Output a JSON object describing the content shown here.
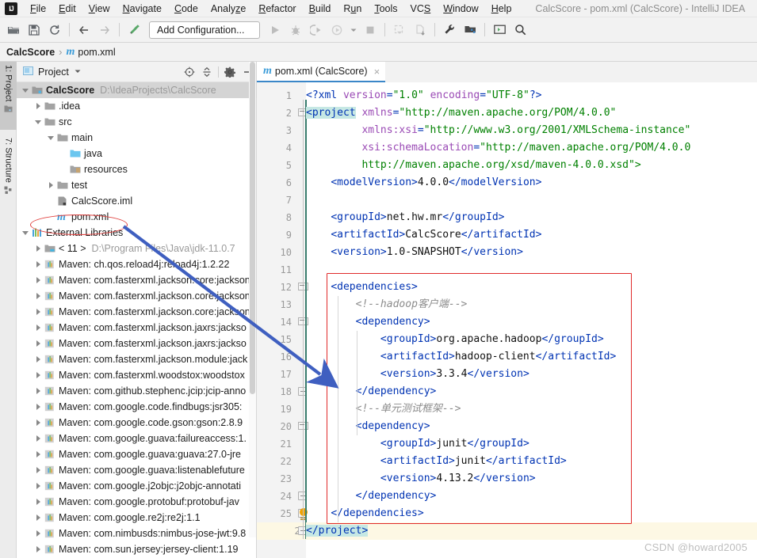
{
  "window": {
    "title": "CalcScore - pom.xml (CalcScore) - IntelliJ IDEA",
    "logo_text": "IJ"
  },
  "menubar": {
    "items": [
      {
        "label": "File",
        "mnemonic": "F"
      },
      {
        "label": "Edit",
        "mnemonic": "E"
      },
      {
        "label": "View",
        "mnemonic": "V"
      },
      {
        "label": "Navigate",
        "mnemonic": "N"
      },
      {
        "label": "Code",
        "mnemonic": "C"
      },
      {
        "label": "Analyze",
        "mnemonic": "z"
      },
      {
        "label": "Refactor",
        "mnemonic": "R"
      },
      {
        "label": "Build",
        "mnemonic": "B"
      },
      {
        "label": "Run",
        "mnemonic": "u"
      },
      {
        "label": "Tools",
        "mnemonic": "T"
      },
      {
        "label": "VCS",
        "mnemonic": "S"
      },
      {
        "label": "Window",
        "mnemonic": "W"
      },
      {
        "label": "Help",
        "mnemonic": "H"
      }
    ]
  },
  "toolbar": {
    "run_config_label": "Add Configuration...",
    "icons": [
      "open-folder-icon",
      "save-all-icon",
      "sync-refresh-icon",
      "back-arrow-icon",
      "forward-arrow-icon",
      "build-hammer-icon",
      "run-icon",
      "debug-icon",
      "run-with-coverage-icon",
      "profile-icon",
      "dropdown-chevron-icon",
      "stop-icon",
      "update-project-icon",
      "commit-icon",
      "settings-wrench-icon",
      "project-structure-icon",
      "terminal-icon",
      "search-everywhere-icon"
    ]
  },
  "breadcrumb": {
    "project": "CalcScore",
    "separator": "›",
    "file": "pom.xml",
    "file_icon": "maven-m-icon"
  },
  "tool_stripe": {
    "tabs": [
      {
        "label": "1: Project",
        "icon": "project-folder-icon",
        "active": true
      },
      {
        "label": "7: Structure",
        "icon": "structure-icon",
        "active": false
      }
    ]
  },
  "project_panel": {
    "title": "Project",
    "title_icon": "project-view-icon",
    "dropdown_icon": "chevron-down-icon",
    "header_buttons": [
      {
        "name": "scroll-from-source-icon",
        "glyph": "⊕"
      },
      {
        "name": "collapse-all-icon",
        "glyph": "⩵"
      },
      {
        "name": "settings-gear-icon",
        "glyph": "⚙"
      },
      {
        "name": "hide-panel-icon",
        "glyph": "—"
      }
    ],
    "tree": [
      {
        "depth": 0,
        "toggle": "down",
        "icon": "project-module-icon",
        "label": "CalcScore",
        "bold": true,
        "path": "D:\\IdeaProjects\\CalcScore",
        "selected": true
      },
      {
        "depth": 1,
        "toggle": "right",
        "icon": "folder-icon",
        "label": ".idea",
        "bold": false,
        "path": "",
        "selected": false
      },
      {
        "depth": 1,
        "toggle": "down",
        "icon": "folder-icon",
        "label": "src",
        "bold": false,
        "path": "",
        "selected": false
      },
      {
        "depth": 2,
        "toggle": "down",
        "icon": "folder-icon",
        "label": "main",
        "bold": false,
        "path": "",
        "selected": false
      },
      {
        "depth": 3,
        "toggle": "none",
        "icon": "source-folder-icon",
        "label": "java",
        "bold": false,
        "path": "",
        "selected": false
      },
      {
        "depth": 3,
        "toggle": "none",
        "icon": "resources-folder-icon",
        "label": "resources",
        "bold": false,
        "path": "",
        "selected": false
      },
      {
        "depth": 2,
        "toggle": "right",
        "icon": "folder-icon",
        "label": "test",
        "bold": false,
        "path": "",
        "selected": false
      },
      {
        "depth": 2,
        "toggle": "none",
        "icon": "iml-file-icon",
        "label": "CalcScore.iml",
        "bold": false,
        "path": "",
        "selected": false
      },
      {
        "depth": 2,
        "toggle": "none",
        "icon": "maven-m-icon",
        "label": "pom.xml",
        "bold": false,
        "path": "",
        "selected": false
      },
      {
        "depth": 0,
        "toggle": "down",
        "icon": "external-libraries-icon",
        "label": "External Libraries",
        "bold": false,
        "path": "",
        "selected": false
      },
      {
        "depth": 1,
        "toggle": "right",
        "icon": "jdk-icon",
        "label": "< 11 >",
        "bold": false,
        "path": "D:\\Program Files\\Java\\jdk-11.0.7",
        "selected": false
      },
      {
        "depth": 1,
        "toggle": "right",
        "icon": "library-icon",
        "label": "Maven: ch.qos.reload4j:reload4j:1.2.22",
        "bold": false,
        "path": "",
        "selected": false
      },
      {
        "depth": 1,
        "toggle": "right",
        "icon": "library-icon",
        "label": "Maven: com.fasterxml.jackson.core:jackson",
        "bold": false,
        "path": "",
        "selected": false
      },
      {
        "depth": 1,
        "toggle": "right",
        "icon": "library-icon",
        "label": "Maven: com.fasterxml.jackson.core:jackson",
        "bold": false,
        "path": "",
        "selected": false
      },
      {
        "depth": 1,
        "toggle": "right",
        "icon": "library-icon",
        "label": "Maven: com.fasterxml.jackson.core:jackson",
        "bold": false,
        "path": "",
        "selected": false
      },
      {
        "depth": 1,
        "toggle": "right",
        "icon": "library-icon",
        "label": "Maven: com.fasterxml.jackson.jaxrs:jackso",
        "bold": false,
        "path": "",
        "selected": false
      },
      {
        "depth": 1,
        "toggle": "right",
        "icon": "library-icon",
        "label": "Maven: com.fasterxml.jackson.jaxrs:jackso",
        "bold": false,
        "path": "",
        "selected": false
      },
      {
        "depth": 1,
        "toggle": "right",
        "icon": "library-icon",
        "label": "Maven: com.fasterxml.jackson.module:jack",
        "bold": false,
        "path": "",
        "selected": false
      },
      {
        "depth": 1,
        "toggle": "right",
        "icon": "library-icon",
        "label": "Maven: com.fasterxml.woodstox:woodstox",
        "bold": false,
        "path": "",
        "selected": false
      },
      {
        "depth": 1,
        "toggle": "right",
        "icon": "library-icon",
        "label": "Maven: com.github.stephenc.jcip:jcip-anno",
        "bold": false,
        "path": "",
        "selected": false
      },
      {
        "depth": 1,
        "toggle": "right",
        "icon": "library-icon",
        "label": "Maven: com.google.code.findbugs:jsr305:",
        "bold": false,
        "path": "",
        "selected": false
      },
      {
        "depth": 1,
        "toggle": "right",
        "icon": "library-icon",
        "label": "Maven: com.google.code.gson:gson:2.8.9",
        "bold": false,
        "path": "",
        "selected": false
      },
      {
        "depth": 1,
        "toggle": "right",
        "icon": "library-icon",
        "label": "Maven: com.google.guava:failureaccess:1.",
        "bold": false,
        "path": "",
        "selected": false
      },
      {
        "depth": 1,
        "toggle": "right",
        "icon": "library-icon",
        "label": "Maven: com.google.guava:guava:27.0-jre",
        "bold": false,
        "path": "",
        "selected": false
      },
      {
        "depth": 1,
        "toggle": "right",
        "icon": "library-icon",
        "label": "Maven: com.google.guava:listenablefuture",
        "bold": false,
        "path": "",
        "selected": false
      },
      {
        "depth": 1,
        "toggle": "right",
        "icon": "library-icon",
        "label": "Maven: com.google.j2objc:j2objc-annotati",
        "bold": false,
        "path": "",
        "selected": false
      },
      {
        "depth": 1,
        "toggle": "right",
        "icon": "library-icon",
        "label": "Maven: com.google.protobuf:protobuf-jav",
        "bold": false,
        "path": "",
        "selected": false
      },
      {
        "depth": 1,
        "toggle": "right",
        "icon": "library-icon",
        "label": "Maven: com.google.re2j:re2j:1.1",
        "bold": false,
        "path": "",
        "selected": false
      },
      {
        "depth": 1,
        "toggle": "right",
        "icon": "library-icon",
        "label": "Maven: com.nimbusds:nimbus-jose-jwt:9.8",
        "bold": false,
        "path": "",
        "selected": false
      },
      {
        "depth": 1,
        "toggle": "right",
        "icon": "library-icon",
        "label": "Maven: com.sun.jersey:jersey-client:1.19",
        "bold": false,
        "path": "",
        "selected": false
      }
    ]
  },
  "editor": {
    "tab": {
      "label": "pom.xml (CalcScore)",
      "icon": "maven-m-icon",
      "close_glyph": "×"
    },
    "first_line": 1,
    "last_line": 26,
    "caret_line": 26,
    "lines": [
      {
        "n": 1,
        "fold": null,
        "segs": [
          {
            "t": "<?xml ",
            "c": "tg"
          },
          {
            "t": "version",
            "c": "at"
          },
          {
            "t": "=",
            "c": "tg"
          },
          {
            "t": "\"1.0\"",
            "c": "st"
          },
          {
            "t": " ",
            "c": "tx"
          },
          {
            "t": "encoding",
            "c": "at"
          },
          {
            "t": "=",
            "c": "tg"
          },
          {
            "t": "\"UTF-8\"",
            "c": "st"
          },
          {
            "t": "?>",
            "c": "tg"
          }
        ],
        "indent": 1
      },
      {
        "n": 2,
        "fold": "open",
        "segs": [
          {
            "t": "<project",
            "c": "tg hi"
          },
          {
            "t": " ",
            "c": "tx"
          },
          {
            "t": "xmlns",
            "c": "at"
          },
          {
            "t": "=",
            "c": "tg"
          },
          {
            "t": "\"http://maven.apache.org/POM/4.0.0\"",
            "c": "st"
          }
        ],
        "indent": 1
      },
      {
        "n": 3,
        "fold": null,
        "segs": [
          {
            "t": "         ",
            "c": "tx"
          },
          {
            "t": "xmlns:xsi",
            "c": "at"
          },
          {
            "t": "=",
            "c": "tg"
          },
          {
            "t": "\"http://www.w3.org/2001/XMLSchema-instance\"",
            "c": "st"
          }
        ],
        "indent": 1
      },
      {
        "n": 4,
        "fold": null,
        "segs": [
          {
            "t": "         ",
            "c": "tx"
          },
          {
            "t": "xsi:schemaLocation",
            "c": "at"
          },
          {
            "t": "=",
            "c": "tg"
          },
          {
            "t": "\"http://maven.apache.org/POM/4.0.0",
            "c": "st"
          }
        ],
        "indent": 1
      },
      {
        "n": 5,
        "fold": null,
        "segs": [
          {
            "t": "         ",
            "c": "tx"
          },
          {
            "t": "http://maven.apache.org/xsd/maven-4.0.0.xsd\">",
            "c": "st"
          }
        ],
        "indent": 1
      },
      {
        "n": 6,
        "fold": null,
        "segs": [
          {
            "t": "    ",
            "c": "tx"
          },
          {
            "t": "<modelVersion>",
            "c": "tg"
          },
          {
            "t": "4.0.0",
            "c": "tx"
          },
          {
            "t": "</modelVersion>",
            "c": "tg"
          }
        ],
        "indent": 1
      },
      {
        "n": 7,
        "fold": null,
        "segs": [],
        "indent": 1
      },
      {
        "n": 8,
        "fold": null,
        "segs": [
          {
            "t": "    ",
            "c": "tx"
          },
          {
            "t": "<groupId>",
            "c": "tg"
          },
          {
            "t": "net.hw.mr",
            "c": "tx"
          },
          {
            "t": "</groupId>",
            "c": "tg"
          }
        ],
        "indent": 1
      },
      {
        "n": 9,
        "fold": null,
        "segs": [
          {
            "t": "    ",
            "c": "tx"
          },
          {
            "t": "<artifactId>",
            "c": "tg"
          },
          {
            "t": "CalcScore",
            "c": "tx"
          },
          {
            "t": "</artifactId>",
            "c": "tg"
          }
        ],
        "indent": 1
      },
      {
        "n": 10,
        "fold": null,
        "segs": [
          {
            "t": "    ",
            "c": "tx"
          },
          {
            "t": "<version>",
            "c": "tg"
          },
          {
            "t": "1.0-SNAPSHOT",
            "c": "tx"
          },
          {
            "t": "</version>",
            "c": "tg"
          }
        ],
        "indent": 1
      },
      {
        "n": 11,
        "fold": null,
        "segs": [],
        "indent": 1
      },
      {
        "n": 12,
        "fold": "open",
        "segs": [
          {
            "t": "    ",
            "c": "tx"
          },
          {
            "t": "<dependencies>",
            "c": "tg"
          }
        ],
        "indent": 1
      },
      {
        "n": 13,
        "fold": null,
        "segs": [
          {
            "t": "        ",
            "c": "tx"
          },
          {
            "t": "<!--hadoop客户端-->",
            "c": "cm"
          }
        ],
        "indent": 2
      },
      {
        "n": 14,
        "fold": "open",
        "segs": [
          {
            "t": "        ",
            "c": "tx"
          },
          {
            "t": "<dependency>",
            "c": "tg"
          }
        ],
        "indent": 2
      },
      {
        "n": 15,
        "fold": null,
        "segs": [
          {
            "t": "            ",
            "c": "tx"
          },
          {
            "t": "<groupId>",
            "c": "tg"
          },
          {
            "t": "org.apache.hadoop",
            "c": "tx"
          },
          {
            "t": "</groupId>",
            "c": "tg"
          }
        ],
        "indent": 3
      },
      {
        "n": 16,
        "fold": null,
        "segs": [
          {
            "t": "            ",
            "c": "tx"
          },
          {
            "t": "<artifactId>",
            "c": "tg"
          },
          {
            "t": "hadoop-client",
            "c": "tx"
          },
          {
            "t": "</artifactId>",
            "c": "tg"
          }
        ],
        "indent": 3
      },
      {
        "n": 17,
        "fold": null,
        "segs": [
          {
            "t": "            ",
            "c": "tx"
          },
          {
            "t": "<version>",
            "c": "tg"
          },
          {
            "t": "3.3.4",
            "c": "tx"
          },
          {
            "t": "</version>",
            "c": "tg"
          }
        ],
        "indent": 3
      },
      {
        "n": 18,
        "fold": "close",
        "segs": [
          {
            "t": "        ",
            "c": "tx"
          },
          {
            "t": "</dependency>",
            "c": "tg"
          }
        ],
        "indent": 2
      },
      {
        "n": 19,
        "fold": null,
        "segs": [
          {
            "t": "        ",
            "c": "tx"
          },
          {
            "t": "<!--单元测试框架-->",
            "c": "cm"
          }
        ],
        "indent": 2
      },
      {
        "n": 20,
        "fold": "open",
        "segs": [
          {
            "t": "        ",
            "c": "tx"
          },
          {
            "t": "<dependency>",
            "c": "tg"
          }
        ],
        "indent": 2
      },
      {
        "n": 21,
        "fold": null,
        "segs": [
          {
            "t": "            ",
            "c": "tx"
          },
          {
            "t": "<groupId>",
            "c": "tg"
          },
          {
            "t": "junit",
            "c": "tx"
          },
          {
            "t": "</groupId>",
            "c": "tg"
          }
        ],
        "indent": 3
      },
      {
        "n": 22,
        "fold": null,
        "segs": [
          {
            "t": "            ",
            "c": "tx"
          },
          {
            "t": "<artifactId>",
            "c": "tg"
          },
          {
            "t": "junit",
            "c": "tx"
          },
          {
            "t": "</artifactId>",
            "c": "tg"
          }
        ],
        "indent": 3
      },
      {
        "n": 23,
        "fold": null,
        "segs": [
          {
            "t": "            ",
            "c": "tx"
          },
          {
            "t": "<version>",
            "c": "tg"
          },
          {
            "t": "4.13.2",
            "c": "tx"
          },
          {
            "t": "</version>",
            "c": "tg"
          }
        ],
        "indent": 3
      },
      {
        "n": 24,
        "fold": "close",
        "segs": [
          {
            "t": "        ",
            "c": "tx"
          },
          {
            "t": "</dependency>",
            "c": "tg"
          }
        ],
        "indent": 2
      },
      {
        "n": 25,
        "fold": "close",
        "segs": [
          {
            "t": "    ",
            "c": "tx"
          },
          {
            "t": "</dependencies>",
            "c": "tg"
          }
        ],
        "indent": 1
      },
      {
        "n": 26,
        "fold": "close",
        "segs": [
          {
            "t": "</project>",
            "c": "tg hi"
          }
        ],
        "indent": 0,
        "caret": true
      }
    ]
  },
  "annotations": {
    "ellipse_target": "pom.xml",
    "rect_target": "dependencies-block",
    "arrow_color": "#3f5fc0",
    "rect_color": "#e02b2b",
    "ellipse_color": "#e0403e"
  },
  "watermark": {
    "text": "CSDN @howard2005"
  }
}
